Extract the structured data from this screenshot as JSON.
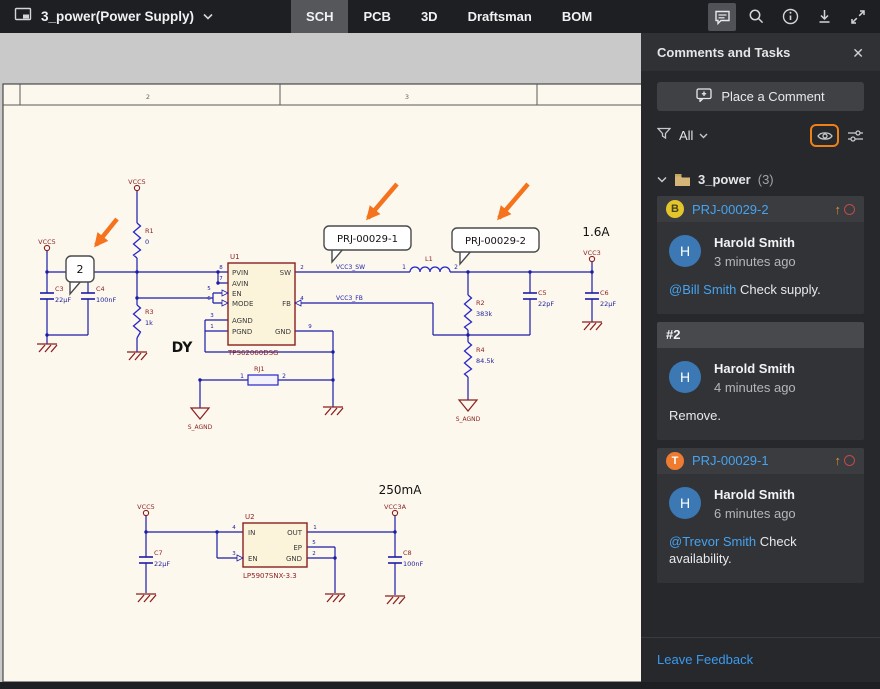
{
  "colors": {
    "highlight_orange": "#ef8018",
    "annotation_arrow_orange": "#f4731c",
    "link_blue": "#46a3f0",
    "badge_yellow": "#e3c62c",
    "badge_orange": "#ee7b30",
    "avatar_blue": "#3c78b4",
    "wire_navy": "#1c1ca8",
    "component_maroon": "#8b1f1f",
    "sheet_cream": "#fcf8ee"
  },
  "topbar": {
    "doc_icon": "schematic-sheet-icon",
    "title": "3_power(Power Supply)",
    "tabs": [
      "SCH",
      "PCB",
      "3D",
      "Draftsman",
      "BOM"
    ],
    "active_tab": "SCH",
    "icon_names": [
      "comments-icon",
      "search-icon",
      "info-icon",
      "download-icon",
      "fullscreen-icon"
    ]
  },
  "panel": {
    "title": "Comments and Tasks",
    "close_label": "✕",
    "place_comment_label": "Place a Comment",
    "filter": {
      "label": "All",
      "icon_names": [
        "funnel-icon",
        "eye-icon",
        "sliders-icon"
      ]
    },
    "tree": {
      "name": "3_power",
      "count": "(3)"
    },
    "cards": [
      {
        "id": "PRJ-00029-2",
        "badge": "B",
        "author": "Harold Smith",
        "time": "3 minutes ago",
        "mention": "@Bill Smith",
        "text": "Check supply.",
        "avatar": "H"
      },
      {
        "id": "#2",
        "badge": "",
        "author": "Harold Smith",
        "time": "4 minutes ago",
        "mention": "",
        "text": "Remove.",
        "avatar": "H"
      },
      {
        "id": "PRJ-00029-1",
        "badge": "T",
        "author": "Harold Smith",
        "time": "6 minutes ago",
        "mention": "@Trevor Smith",
        "text": "Check availability.",
        "avatar": "H"
      }
    ],
    "footer_link": "Leave Feedback"
  },
  "schematic": {
    "cols": [
      "2",
      "3"
    ],
    "balloon_2": "2",
    "balloon_prj1": "PRJ-00029-1",
    "balloon_prj2": "PRJ-00029-2",
    "ann_current_buck": "1.6A",
    "ann_current_ldo": "250mA",
    "ann_dy": "DY",
    "nets": {
      "vcc5": "VCC5",
      "vcc3": "VCC3",
      "vcc3a": "VCC3A",
      "vcc3sw": "VCC3_SW",
      "vcc3fb": "VCC3_FB",
      "sagnd": "S_AGND"
    },
    "u1": {
      "ref": "U1",
      "part": "TPS62060DSG",
      "left_pins": [
        "PVIN",
        "AVIN",
        "EN",
        "MODE",
        "AGND",
        "PGND"
      ],
      "left_nums": [
        "8",
        "7",
        "5",
        "6",
        "3",
        "1"
      ],
      "right_pins": [
        "SW",
        "FB",
        "GND"
      ],
      "right_nums": [
        "2",
        "4",
        "9"
      ]
    },
    "u2": {
      "ref": "U2",
      "part": "LP5907SNX-3.3",
      "left_pins": [
        "IN",
        "EN"
      ],
      "left_nums": [
        "4",
        "3"
      ],
      "right_pins": [
        "OUT",
        "EP",
        "GND"
      ],
      "right_nums": [
        "1",
        "5",
        "2"
      ]
    },
    "r1": {
      "ref": "R1",
      "val": "0"
    },
    "r2": {
      "ref": "R2",
      "val": "383k"
    },
    "r3": {
      "ref": "R3",
      "val": "1k"
    },
    "r4": {
      "ref": "R4",
      "val": "84.5k"
    },
    "rj1": {
      "ref": "RJ1",
      "p1": "1",
      "p2": "2"
    },
    "l1": {
      "ref": "L1",
      "p1": "1",
      "p2": "2"
    },
    "c3": {
      "ref": "C3",
      "val": "22µF"
    },
    "c4": {
      "ref": "C4",
      "val": "100nF"
    },
    "c5": {
      "ref": "C5",
      "val": "22pF"
    },
    "c6": {
      "ref": "C6",
      "val": "22µF"
    },
    "c7": {
      "ref": "C7",
      "val": "22µF"
    },
    "c8": {
      "ref": "C8",
      "val": "100nF"
    }
  }
}
